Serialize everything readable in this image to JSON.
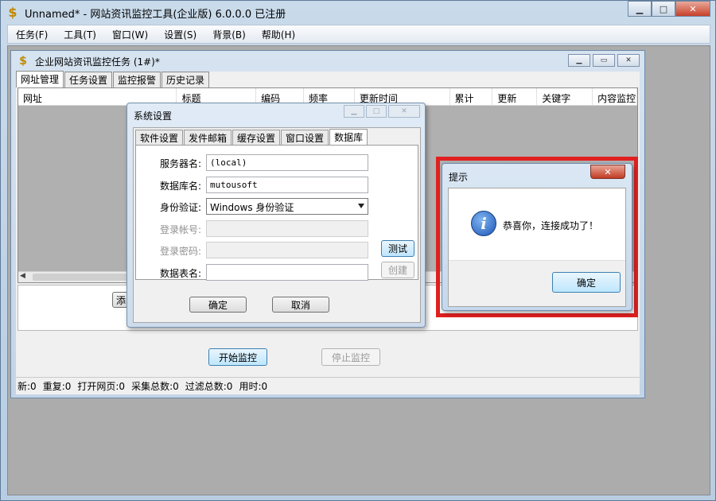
{
  "app": {
    "logo_glyph": "$",
    "title": "Unnamed* - 网站资讯监控工具(企业版) 6.0.0.0  已注册",
    "caption": {
      "minimize": "▁",
      "maximize": "□",
      "close": "✕"
    }
  },
  "menu": [
    "任务(F)",
    "工具(T)",
    "窗口(W)",
    "设置(S)",
    "背景(B)",
    "帮助(H)"
  ],
  "child": {
    "title": "企业网站资讯监控任务 (1#)*",
    "caption": {
      "minimize": "▁",
      "restore": "▭",
      "close": "✕"
    },
    "tabs": [
      {
        "label": "网址管理",
        "active": true
      },
      {
        "label": "任务设置",
        "active": false
      },
      {
        "label": "监控报警",
        "active": false
      },
      {
        "label": "历史记录",
        "active": false
      }
    ],
    "grid_columns": [
      "网址",
      "标题",
      "编码",
      "频率",
      "更新时间",
      "累计",
      "更新",
      "关键字",
      "内容监控"
    ],
    "hscroll_arrow": "◀",
    "add_button_partial": "添",
    "start_button": "开始监控",
    "stop_button": "停止监控",
    "status": [
      "新:0",
      "重复:0",
      "打开网页:0",
      "采集总数:0",
      "过滤总数:0",
      "用时:0"
    ]
  },
  "settings_dialog": {
    "title": "系统设置",
    "caption": {
      "minimize": "▁",
      "maximize": "□",
      "close": "✕"
    },
    "tabs": [
      {
        "label": "软件设置",
        "active": false
      },
      {
        "label": "发件邮箱",
        "active": false
      },
      {
        "label": "缓存设置",
        "active": false
      },
      {
        "label": "窗口设置",
        "active": false
      },
      {
        "label": "数据库",
        "active": true
      }
    ],
    "server_label": "服务器名:",
    "server_value": "(local)",
    "db_label": "数据库名:",
    "db_value": "mutousoft",
    "auth_label": "身份验证:",
    "auth_value": "Windows 身份验证",
    "login_label": "登录帐号:",
    "password_label": "登录密码:",
    "table_label": "数据表名:",
    "test_button": "测试",
    "create_button": "创建",
    "ok_button": "确定",
    "cancel_button": "取消"
  },
  "message_box": {
    "title": "提示",
    "icon": "information-icon",
    "icon_glyph": "i",
    "close": "✕",
    "message": "恭喜你，连接成功了！",
    "ok_button": "确定"
  },
  "colors": {
    "highlight_border": "#e02020",
    "workspace": "#acacac",
    "window_frame": "#c9daea"
  }
}
